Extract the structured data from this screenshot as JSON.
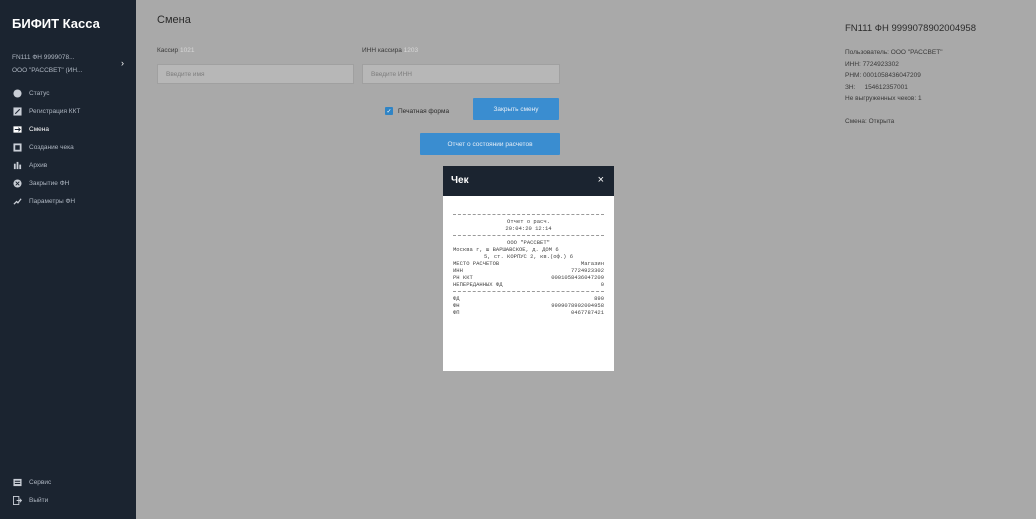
{
  "sidebar": {
    "title": "БИФИТ Касса",
    "device_line1": "FN111 ФН 9999078...",
    "device_line2": "ООО \"РАССВЕТ\" (ИН...",
    "items": [
      {
        "label": "Статус",
        "icon": "status-icon"
      },
      {
        "label": "Регистрация ККТ",
        "icon": "registration-icon"
      },
      {
        "label": "Смена",
        "icon": "shift-icon"
      },
      {
        "label": "Создание чека",
        "icon": "receipt-icon"
      },
      {
        "label": "Архив",
        "icon": "archive-icon"
      },
      {
        "label": "Закрытие ФН",
        "icon": "close-fn-icon"
      },
      {
        "label": "Параметры ФН",
        "icon": "params-icon"
      }
    ],
    "bottom_items": [
      {
        "label": "Сервис",
        "icon": "service-icon"
      },
      {
        "label": "Выйти",
        "icon": "logout-icon"
      }
    ]
  },
  "main": {
    "title": "Смена",
    "cashier_label": "Кассир",
    "cashier_tag": "1021",
    "cashier_placeholder": "Введите имя",
    "inn_label": "ИНН кассира",
    "inn_tag": "1203",
    "inn_placeholder": "Введите ИНН",
    "print_form_label": "Печатная форма",
    "close_shift_button": "Закрыть смену",
    "report_button": "Отчет о состоянии расчетов"
  },
  "right_panel": {
    "title": "FN111 ФН 9999078902004958",
    "lines": [
      "Пользователь: ООО \"РАССВЕТ\"",
      "ИНН: 7724923302",
      "РНМ: 0001058436047209",
      "ЗН:     154612357001",
      "Не выгруженных чеков: 1",
      "",
      "Смена: Открыта"
    ]
  },
  "modal": {
    "title": "Чек",
    "close_glyph": "×",
    "receipt": {
      "header1": "Отчет о расч.",
      "header2": "20:04:20 12:14",
      "org": "ООО \"РАССВЕТ\"",
      "address1": "Москва г, ш ВАРШАВСКОЕ, д. ДОМ 6",
      "address2": "5, ст. КОРПУС 2, кв.(оф.) 6",
      "rows1": [
        {
          "k": "МЕСТО РАСЧЕТОВ",
          "v": "Магазин"
        },
        {
          "k": "ИНН",
          "v": "7724923302"
        },
        {
          "k": "РН ККТ",
          "v": "0001058436047209"
        },
        {
          "k": "НЕПЕРЕДАННЫХ ФД",
          "v": "0"
        }
      ],
      "rows2": [
        {
          "k": "ФД",
          "v": "890"
        },
        {
          "k": "ФН",
          "v": "9999078902004958"
        },
        {
          "k": "ФП",
          "v": "0467787421"
        }
      ]
    }
  }
}
